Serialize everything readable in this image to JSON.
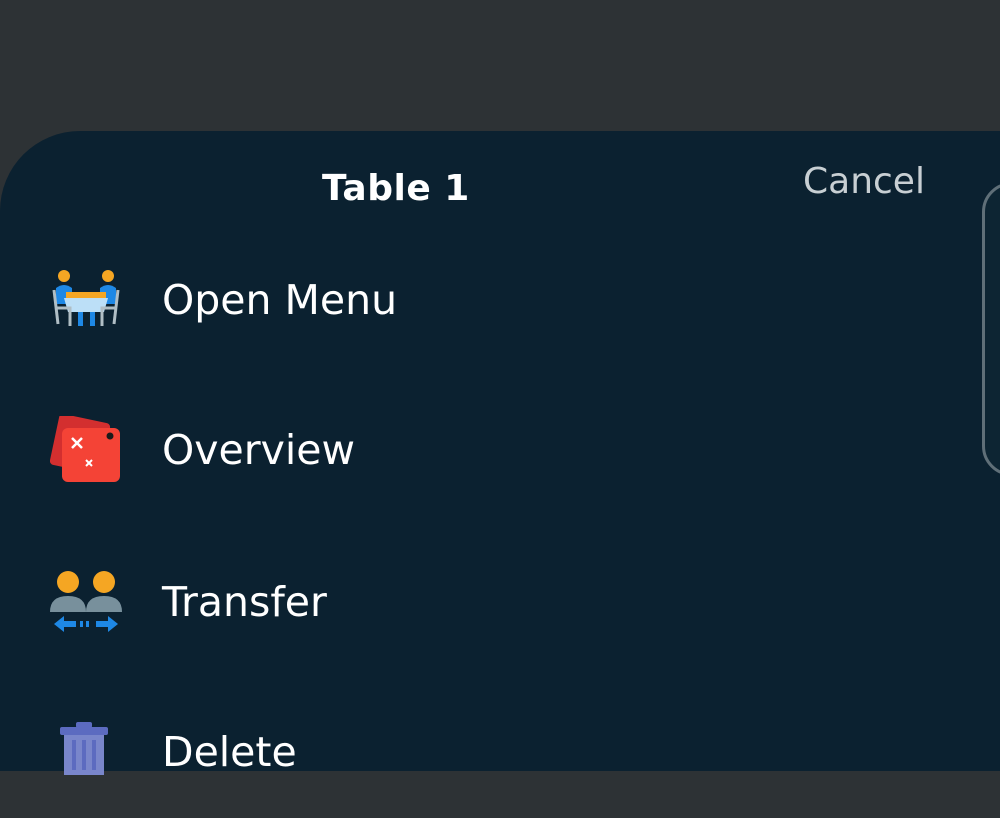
{
  "sheet": {
    "title": "Table 1",
    "cancel_label": "Cancel"
  },
  "menu": {
    "items": [
      {
        "label": "Open Menu",
        "icon": "dining-table-icon"
      },
      {
        "label": "Overview",
        "icon": "dice-icon"
      },
      {
        "label": "Transfer",
        "icon": "transfer-people-icon"
      },
      {
        "label": "Delete",
        "icon": "trash-icon"
      }
    ]
  },
  "colors": {
    "backdrop": "#2d3235",
    "sheet": "#0b2130",
    "text": "#ffffff",
    "cancel": "#c8cfd3"
  }
}
